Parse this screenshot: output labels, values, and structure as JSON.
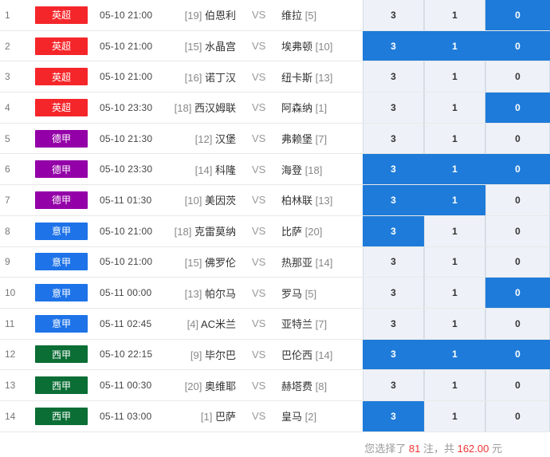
{
  "colors": {
    "英超": "#f5262a",
    "德甲": "#9400a8",
    "意甲": "#1e73e8",
    "西甲": "#0a6e35"
  },
  "vs_label": "VS",
  "rows": [
    {
      "num": "1",
      "league": "英超",
      "time": "05-10 21:00",
      "home_rank": "[19]",
      "home": "伯恩利",
      "away": "维拉",
      "away_rank": "[5]",
      "odds": [
        "3",
        "1",
        "0"
      ],
      "selected": [
        false,
        false,
        true
      ]
    },
    {
      "num": "2",
      "league": "英超",
      "time": "05-10 21:00",
      "home_rank": "[15]",
      "home": "水晶宫",
      "away": "埃弗顿",
      "away_rank": "[10]",
      "odds": [
        "3",
        "1",
        "0"
      ],
      "selected": [
        true,
        true,
        true
      ]
    },
    {
      "num": "3",
      "league": "英超",
      "time": "05-10 21:00",
      "home_rank": "[16]",
      "home": "诺丁汉",
      "away": "纽卡斯",
      "away_rank": "[13]",
      "odds": [
        "3",
        "1",
        "0"
      ],
      "selected": [
        false,
        false,
        false
      ]
    },
    {
      "num": "4",
      "league": "英超",
      "time": "05-10 23:30",
      "home_rank": "[18]",
      "home": "西汉姆联",
      "away": "阿森纳",
      "away_rank": "[1]",
      "odds": [
        "3",
        "1",
        "0"
      ],
      "selected": [
        false,
        false,
        true
      ]
    },
    {
      "num": "5",
      "league": "德甲",
      "time": "05-10 21:30",
      "home_rank": "[12]",
      "home": "汉堡",
      "away": "弗赖堡",
      "away_rank": "[7]",
      "odds": [
        "3",
        "1",
        "0"
      ],
      "selected": [
        false,
        false,
        false
      ]
    },
    {
      "num": "6",
      "league": "德甲",
      "time": "05-10 23:30",
      "home_rank": "[14]",
      "home": "科隆",
      "away": "海登",
      "away_rank": "[18]",
      "odds": [
        "3",
        "1",
        "0"
      ],
      "selected": [
        true,
        true,
        true
      ]
    },
    {
      "num": "7",
      "league": "德甲",
      "time": "05-11 01:30",
      "home_rank": "[10]",
      "home": "美因茨",
      "away": "柏林联",
      "away_rank": "[13]",
      "odds": [
        "3",
        "1",
        "0"
      ],
      "selected": [
        true,
        true,
        false
      ]
    },
    {
      "num": "8",
      "league": "意甲",
      "time": "05-10 21:00",
      "home_rank": "[18]",
      "home": "克雷莫纳",
      "away": "比萨",
      "away_rank": "[20]",
      "odds": [
        "3",
        "1",
        "0"
      ],
      "selected": [
        true,
        false,
        false
      ]
    },
    {
      "num": "9",
      "league": "意甲",
      "time": "05-10 21:00",
      "home_rank": "[15]",
      "home": "佛罗伦",
      "away": "热那亚",
      "away_rank": "[14]",
      "odds": [
        "3",
        "1",
        "0"
      ],
      "selected": [
        false,
        false,
        false
      ]
    },
    {
      "num": "10",
      "league": "意甲",
      "time": "05-11 00:00",
      "home_rank": "[13]",
      "home": "帕尔马",
      "away": "罗马",
      "away_rank": "[5]",
      "odds": [
        "3",
        "1",
        "0"
      ],
      "selected": [
        false,
        false,
        true
      ]
    },
    {
      "num": "11",
      "league": "意甲",
      "time": "05-11 02:45",
      "home_rank": "[4]",
      "home": "AC米兰",
      "away": "亚特兰",
      "away_rank": "[7]",
      "odds": [
        "3",
        "1",
        "0"
      ],
      "selected": [
        false,
        false,
        false
      ]
    },
    {
      "num": "12",
      "league": "西甲",
      "time": "05-10 22:15",
      "home_rank": "[9]",
      "home": "毕尔巴",
      "away": "巴伦西",
      "away_rank": "[14]",
      "odds": [
        "3",
        "1",
        "0"
      ],
      "selected": [
        true,
        true,
        true
      ]
    },
    {
      "num": "13",
      "league": "西甲",
      "time": "05-11 00:30",
      "home_rank": "[20]",
      "home": "奥维耶",
      "away": "赫塔费",
      "away_rank": "[8]",
      "odds": [
        "3",
        "1",
        "0"
      ],
      "selected": [
        false,
        false,
        false
      ]
    },
    {
      "num": "14",
      "league": "西甲",
      "time": "05-11 03:00",
      "home_rank": "[1]",
      "home": "巴萨",
      "away": "皇马",
      "away_rank": "[2]",
      "odds": [
        "3",
        "1",
        "0"
      ],
      "selected": [
        true,
        false,
        false
      ]
    }
  ],
  "summary": {
    "prefix": "您选择了",
    "count": "81",
    "mid": "注，共",
    "amount": "162.00",
    "suffix": "元"
  }
}
